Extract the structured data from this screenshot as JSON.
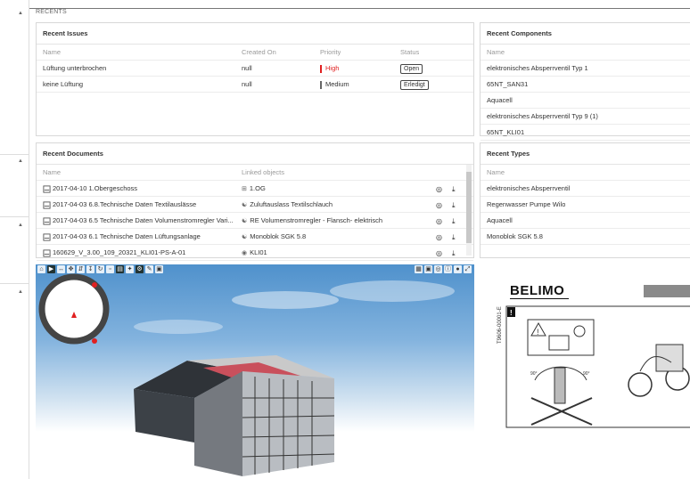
{
  "section": {
    "title": "RECENTS"
  },
  "issues": {
    "title": "Recent Issues",
    "columns": [
      "Name",
      "Created On",
      "Priority",
      "Status"
    ],
    "rows": [
      {
        "name": "Lüftung unterbrochen",
        "created": "null",
        "priority": "High",
        "priority_color": "#e02020",
        "status": "Open"
      },
      {
        "name": "keine Lüftung",
        "created": "null",
        "priority": "Medium",
        "priority_color": "#666666",
        "status": "Erledigt"
      }
    ]
  },
  "components": {
    "title": "Recent Components",
    "columns": [
      "Name"
    ],
    "rows": [
      "elektronisches Absperrventil Typ 1",
      "65NT_SAN31",
      "Aquacell",
      "elektronisches Absperrventil Typ 9 (1)",
      "65NT_KLI01"
    ]
  },
  "documents": {
    "title": "Recent Documents",
    "columns": [
      "Name",
      "Linked objects"
    ],
    "rows": [
      {
        "name": "2017-04-10 1.Obergeschoss",
        "linked": "1.OG",
        "linked_icon": "floor-icon"
      },
      {
        "name": "2017-04-03 6.8.Technische Daten Textilauslässe",
        "linked": "Zuluftauslass Textilschlauch",
        "linked_icon": "component-icon"
      },
      {
        "name": "2017-04-03 6.5 Technische Daten Volumenstromregler Vari...",
        "linked": "RE Volumenstromregler - Flansch- elektrisch",
        "linked_icon": "component-icon"
      },
      {
        "name": "2017-04-03 6.1 Technische Daten Lüftungsanlage",
        "linked": "Monoblok SGK 5.8",
        "linked_icon": "component-icon"
      },
      {
        "name": "160629_V_3.00_109_20321_KLI01-PS-A-01",
        "linked": "KLI01",
        "linked_icon": "system-icon"
      }
    ]
  },
  "types": {
    "title": "Recent Types",
    "columns": [
      "Name"
    ],
    "rows": [
      "elektronisches Absperrventil",
      "Regenwasser Pumpe Wilo",
      "Aquacell",
      "Monoblok SGK 5.8"
    ]
  },
  "document_preview": {
    "brand": "BELIMO",
    "doc_code": "T9606-00001-E",
    "warning_mark": "!",
    "angle_left": "90°",
    "angle_right": "90°"
  },
  "colors": {
    "accent_red": "#e02020",
    "roof_red": "#c9505c"
  }
}
